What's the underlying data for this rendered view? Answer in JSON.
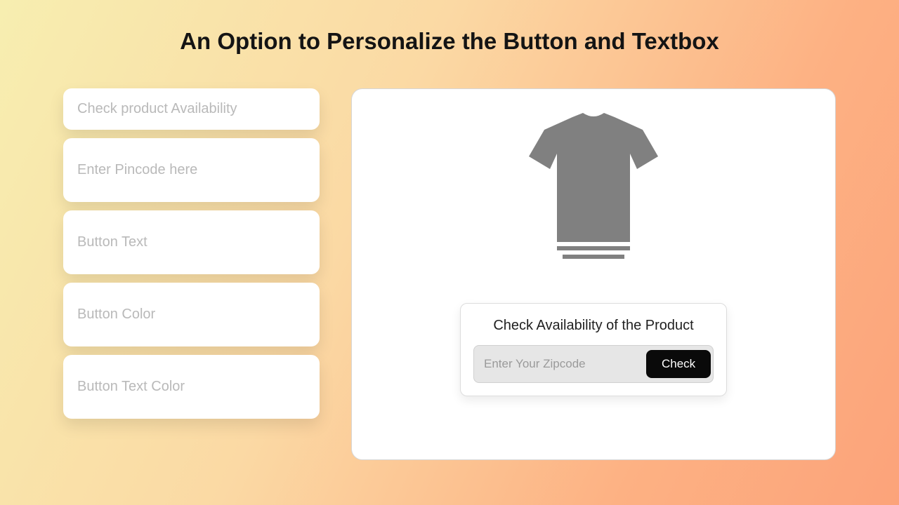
{
  "header": {
    "title": "An Option to Personalize the Button and Textbox"
  },
  "sidebar": {
    "fields": [
      {
        "placeholder": "Check product Availability",
        "name": "availability-text-field",
        "tall": false
      },
      {
        "placeholder": "Enter Pincode here",
        "name": "pincode-placeholder-field",
        "tall": true
      },
      {
        "placeholder": "Button Text",
        "name": "button-text-field",
        "tall": true
      },
      {
        "placeholder": "Button Color",
        "name": "button-color-field",
        "tall": true
      },
      {
        "placeholder": "Button Text Color",
        "name": "button-text-color-field",
        "tall": true
      }
    ]
  },
  "preview": {
    "product_icon": "tshirt-icon",
    "checker": {
      "title": "Check Availability of the Product",
      "input_placeholder": "Enter Your Zipcode",
      "button_label": "Check"
    }
  }
}
